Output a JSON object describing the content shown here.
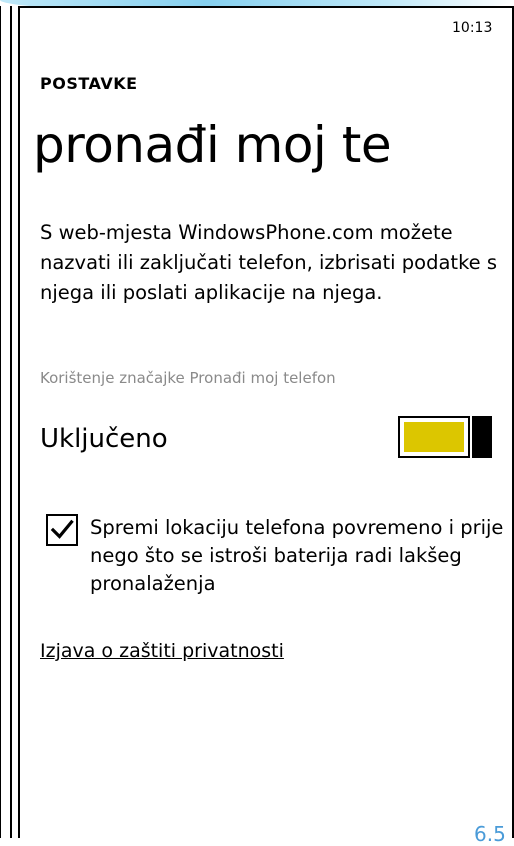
{
  "status_bar": {
    "time": "10:13"
  },
  "header": {
    "section": "POSTAVKE",
    "title": "pronađi moj te"
  },
  "description": "S web-mjesta WindowsPhone.com možete nazvati ili zaključati telefon, izbrisati podatke s njega ili poslati aplikacije na njega.",
  "find_my_phone": {
    "label": "Korištenje značajke Pronađi moj telefon",
    "state": "Uključeno",
    "enabled": true,
    "accent_color": "#dcc600"
  },
  "save_location": {
    "checked": true,
    "label": "Spremi lokaciju telefona povremeno i prije nego što se istroši baterija radi lakšeg pronalaženja"
  },
  "privacy_link": "Izjava o zaštiti privatnosti",
  "slide_number": "6.5"
}
